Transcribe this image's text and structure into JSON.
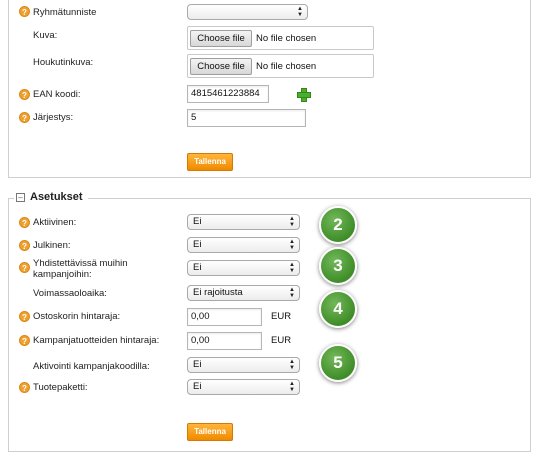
{
  "top_form": {
    "group_id": {
      "label": "Ryhmätunniste",
      "value": ""
    },
    "image": {
      "label": "Kuva:",
      "button": "Choose file",
      "status": "No file chosen"
    },
    "teaser_image": {
      "label": "Houkutinkuva:",
      "button": "Choose file",
      "status": "No file chosen"
    },
    "ean": {
      "label": "EAN koodi:",
      "value": "4815461223884",
      "add_icon": "plus-icon"
    },
    "order": {
      "label": "Järjestys:",
      "value": "5"
    },
    "save_label": "Tallenna"
  },
  "settings": {
    "title": "Asetukset",
    "collapse_symbol": "⊟",
    "active": {
      "label": "Aktiivinen:",
      "value": "Ei"
    },
    "public": {
      "label": "Julkinen:",
      "value": "Ei"
    },
    "combinable_line1": "Yhdistettävissä muihin",
    "combinable_line2": "kampanjoihin:",
    "combinable_value": "Ei",
    "validity": {
      "label": "Voimassaoloaika:",
      "value": "Ei rajoitusta"
    },
    "cart_threshold": {
      "label": "Ostoskorin hintaraja:",
      "value": "0,00",
      "unit": "EUR"
    },
    "campaign_threshold": {
      "label": "Kampanjatuotteiden hintaraja:",
      "value": "0,00",
      "unit": "EUR"
    },
    "code_activation": {
      "label": "Aktivointi kampanjakoodilla:",
      "value": "Ei"
    },
    "product_bundle": {
      "label": "Tuotepaketti:",
      "value": "Ei"
    },
    "save_label": "Tallenna"
  },
  "help_symbol": "?",
  "badges": [
    "2",
    "3",
    "4",
    "5"
  ],
  "colors": {
    "accent_orange": "#f08a00",
    "badge_green": "#4a9a30",
    "plus_green": "#4cae2e"
  }
}
